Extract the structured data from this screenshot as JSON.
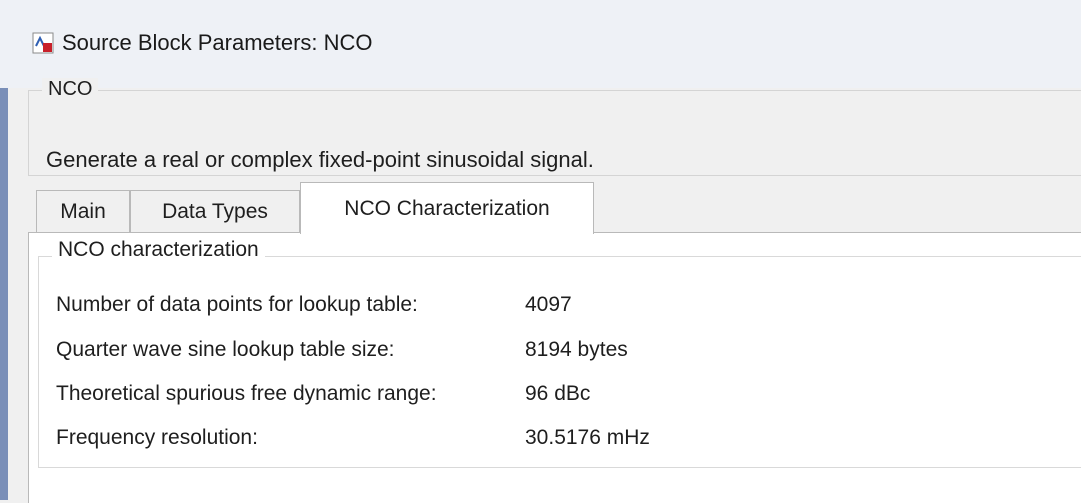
{
  "window": {
    "title": "Source Block Parameters: NCO"
  },
  "block": {
    "legend": "NCO",
    "description": "Generate a real or complex fixed-point sinusoidal signal."
  },
  "tabs": [
    {
      "label": "Main"
    },
    {
      "label": "Data Types"
    },
    {
      "label": "NCO Characterization"
    }
  ],
  "active_tab_index": 2,
  "characterization": {
    "legend": "NCO characterization",
    "rows": [
      {
        "label": "Number of data points for lookup table:",
        "value": "4097"
      },
      {
        "label": "Quarter wave sine lookup table size:",
        "value": "8194 bytes"
      },
      {
        "label": "Theoretical spurious free dynamic range:",
        "value": "96 dBc"
      },
      {
        "label": "Frequency resolution:",
        "value": "30.5176 mHz"
      }
    ]
  },
  "colors": {
    "accent_edge": "#7a8fb8",
    "icon_red": "#c8202a",
    "icon_blue": "#2f5fb3"
  },
  "icons": {
    "window_icon": "simulink-block-icon"
  }
}
